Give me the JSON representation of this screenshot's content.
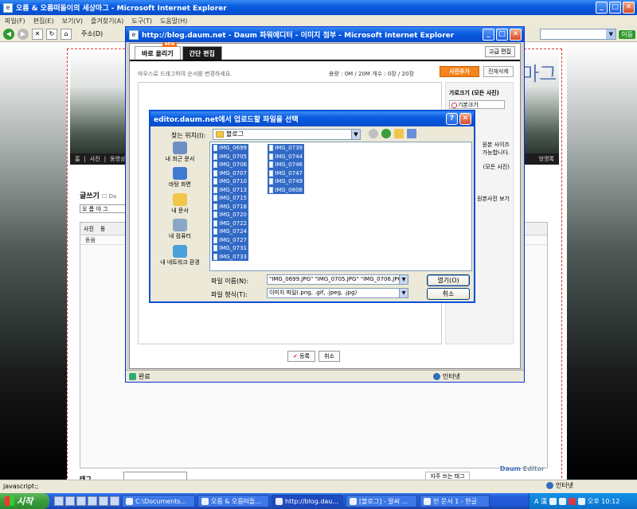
{
  "outer_window": {
    "title": "오름 & 오름떠돌이의 세상마그 - Microsoft Internet Explorer",
    "menu": [
      "파일(F)",
      "편집(E)",
      "보기(V)",
      "즐겨찾기(A)",
      "도구(T)",
      "도움말(H)"
    ],
    "address_label": "주소(D)",
    "go_label": "이동",
    "status_text": "javascript:;",
    "zone_text": "인터넷"
  },
  "blog": {
    "title_fragment": "마그",
    "nav_items": [
      "홈",
      "사진",
      "동영상"
    ],
    "nav_right": "방명록",
    "write_label": "글쓰기",
    "write_checkbox_text": "Da",
    "category": "오 름 야 그",
    "editor_toolbar": [
      "사진",
      "동"
    ],
    "editor_row2": "돋움",
    "editor_brand": "Daum",
    "editor_brand_suffix": "Editor",
    "tag_label": "태그",
    "often_tags_label": "자주 쓰는 태그"
  },
  "attach_window": {
    "title": "http://blog.daum.net - Daum 파워에디터 - 이미지 첨부 - Microsoft Internet Explorer",
    "tabs": [
      {
        "label": "바로 올리기",
        "badge": "NEW"
      },
      {
        "label": "간단 편집"
      }
    ],
    "advanced_edit": "고급 편집",
    "hint": "마우스로 드래그하여 순서를 변경하세요.",
    "count_text": "용량 : 0M / 20M  개수 : 0장 / 20장",
    "add_photo": "사진추가",
    "delete_all": "전체삭제",
    "side": {
      "width_label": "가로크기 (모든 사진)",
      "width_value": "기본크기",
      "note1": "원본 사이즈",
      "note2": "가능합니다.",
      "all_photos": "(모든 사진)",
      "view_original": "원본사진 보기"
    },
    "register": "등록",
    "cancel": "취소",
    "status_text": "완료",
    "zone_text": "인터넷"
  },
  "file_dialog": {
    "title": "editor.daum.net에서 업로드할 파일을 선택",
    "lookin_label": "찾는 위치(I):",
    "lookin_value": "블로그",
    "places": [
      {
        "label": "내 최근 문서",
        "icon": "recent-docs-icon",
        "color": "#6f8fc4"
      },
      {
        "label": "바탕 화면",
        "icon": "desktop-icon",
        "color": "#3e7bd0"
      },
      {
        "label": "내 문서",
        "icon": "my-documents-icon",
        "color": "#f1c74b"
      },
      {
        "label": "내 컴퓨터",
        "icon": "my-computer-icon",
        "color": "#8aa6c9"
      },
      {
        "label": "내 네트워크 환경",
        "icon": "network-icon",
        "color": "#4aa0d8"
      }
    ],
    "files_col1": [
      "IMG_0699",
      "IMG_0705",
      "IMG_0706",
      "IMG_0707",
      "IMG_0710",
      "IMG_0713",
      "IMG_0715",
      "IMG_0718",
      "IMG_0720",
      "IMG_0722",
      "IMG_0724",
      "IMG_0727",
      "IMG_0731",
      "IMG_0733"
    ],
    "files_col2": [
      "IMG_0739",
      "IMG_0744",
      "IMG_0746",
      "IMG_0747",
      "IMG_0749",
      "IMG_0808"
    ],
    "filename_label": "파일 이름(N):",
    "filename_value": "\"IMG_0699.JPG\" \"IMG_0705.JPG\" \"IMG_0706.JPG\"",
    "filetype_label": "파일 형식(T):",
    "filetype_value": "이미지 파일(.png, .gif, .jpeg, .jpg)",
    "open_label": "열기(O)",
    "cancel_label": "취소"
  },
  "taskbar": {
    "start": "시작",
    "tasks": [
      {
        "label": "C:\\Documents...",
        "active": false
      },
      {
        "label": "오름 & 오름떠돌...",
        "active": false
      },
      {
        "label": "http://blog.dau...",
        "active": true
      },
      {
        "label": "[블로그] - 알씨 ...",
        "active": false
      },
      {
        "label": "빈 문서 1 - 한글",
        "active": false
      }
    ],
    "ime": "A 漢",
    "clock": "오후 10:12"
  }
}
